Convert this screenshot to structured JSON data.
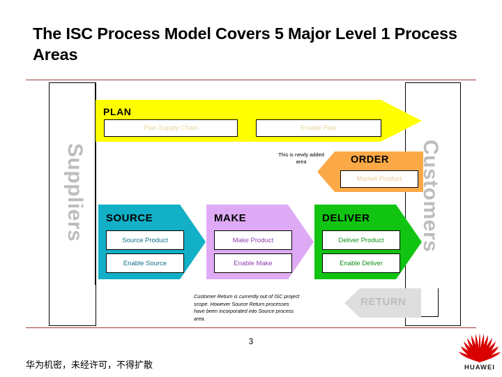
{
  "slide": {
    "title": "The ISC Process Model Covers 5 Major Level 1 Process Areas",
    "page_number": "3",
    "confidential_note": "华为机密，未经许可，不得扩散",
    "brand": "HUAWEI",
    "accent_rule_color": "#9e3b38"
  },
  "diagram": {
    "left_actor": "Suppliers",
    "right_actor": "Customers",
    "plan": {
      "title": "PLAN",
      "color": "#ffff00",
      "label_color": "#e4d79c",
      "boxes": [
        "Plan Supply Chain",
        "Enable Plan"
      ]
    },
    "order": {
      "title": "ORDER",
      "color": "#fba947",
      "label_color": "#f2c893",
      "boxes": [
        "Market Product"
      ],
      "note": "This is newly added area"
    },
    "band": [
      {
        "title": "SOURCE",
        "color": "#12b0c6",
        "label_color": "#0d6f85",
        "boxes": [
          "Source Product",
          "Enable Source"
        ]
      },
      {
        "title": "MAKE",
        "color": "#dfaaf5",
        "label_color": "#8e3fb0",
        "boxes": [
          "Make Product",
          "Enable Make"
        ]
      },
      {
        "title": "DELIVER",
        "color": "#11c411",
        "label_color": "#0e8f16",
        "boxes": [
          "Deliver Product",
          "Enable Deliver"
        ]
      }
    ],
    "return": {
      "title": "RETURN",
      "color": "#dedede",
      "label_color": "#bdbdbd",
      "note": "Customer Return is currently out of ISC project scope. However Source Return processes have been incorporated into Source process area."
    }
  }
}
